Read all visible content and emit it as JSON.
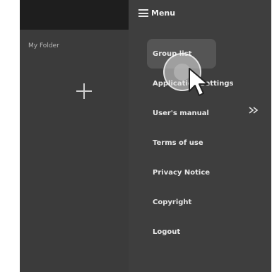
{
  "left_pane": {
    "title": "My Folder"
  },
  "menu": {
    "title": "Menu",
    "items": [
      {
        "label": "Group list"
      },
      {
        "label": "Application Settings"
      },
      {
        "label": "User's manual"
      },
      {
        "label": "Terms of use"
      },
      {
        "label": "Privacy Notice"
      },
      {
        "label": "Copyright"
      },
      {
        "label": "Logout"
      }
    ]
  },
  "colors": {
    "background": "#3a3a3a",
    "topbar": "#1e1e1e",
    "active_item": "#555555",
    "text": "#e6e6e6"
  },
  "icons": [
    "menu-icon",
    "add-icon",
    "collapse-icon",
    "pointer-cursor-icon"
  ]
}
